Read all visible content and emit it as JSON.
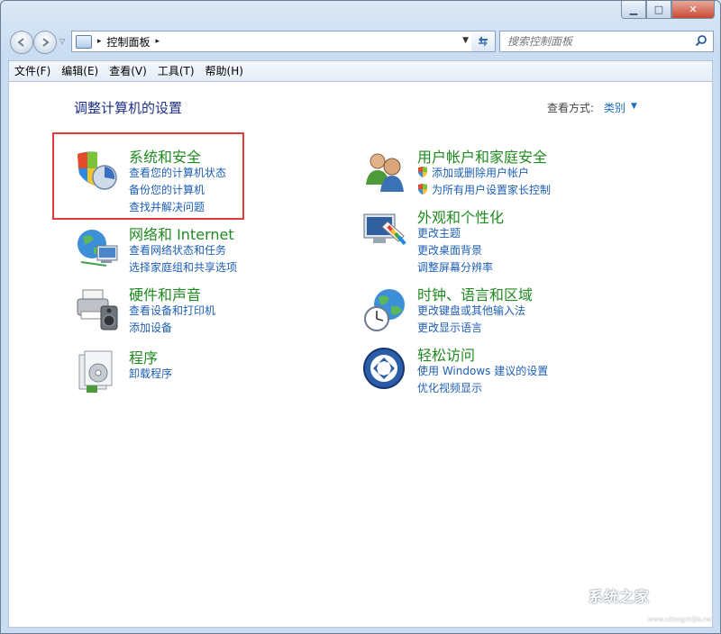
{
  "window": {
    "caption_buttons": {
      "minimize": "▁",
      "maximize": "□",
      "close": "✕"
    }
  },
  "address_bar": {
    "breadcrumb": "控制面板",
    "arrow": "▸"
  },
  "search": {
    "placeholder": "搜索控制面板"
  },
  "menu": [
    "文件(F)",
    "编辑(E)",
    "查看(V)",
    "工具(T)",
    "帮助(H)"
  ],
  "main": {
    "title": "调整计算机的设置",
    "view_by_label": "查看方式:",
    "view_by_value": "类别"
  },
  "categories": [
    {
      "title": "系统和安全",
      "icon": "shield-icon",
      "links": [
        "查看您的计算机状态",
        "备份您的计算机",
        "查找并解决问题"
      ]
    },
    {
      "title": "网络和 Internet",
      "icon": "network-globe-icon",
      "links": [
        "查看网络状态和任务",
        "选择家庭组和共享选项"
      ]
    },
    {
      "title": "硬件和声音",
      "icon": "printer-speaker-icon",
      "links": [
        "查看设备和打印机",
        "添加设备"
      ]
    },
    {
      "title": "程序",
      "icon": "programs-icon",
      "links": [
        "卸载程序"
      ]
    },
    {
      "title": "用户帐户和家庭安全",
      "icon": "users-icon",
      "links": [
        "添加或删除用户帐户",
        "为所有用户设置家长控制"
      ]
    },
    {
      "title": "外观和个性化",
      "icon": "monitor-palette-icon",
      "links": [
        "更改主题",
        "更改桌面背景",
        "调整屏幕分辨率"
      ]
    },
    {
      "title": "时钟、语言和区域",
      "icon": "clock-globe-icon",
      "links": [
        "更改键盘或其他输入法",
        "更改显示语言"
      ]
    },
    {
      "title": "轻松访问",
      "icon": "ease-of-access-icon",
      "links": [
        "使用 Windows 建议的设置",
        "优化视频显示"
      ]
    }
  ],
  "watermark": {
    "text": "系统之家",
    "sub": "www.xitongzhijia.net"
  },
  "colors": {
    "category_title": "#1f8a1f",
    "link": "#1e5fb4",
    "title": "#1e3287",
    "highlight": "#e23a3a"
  }
}
